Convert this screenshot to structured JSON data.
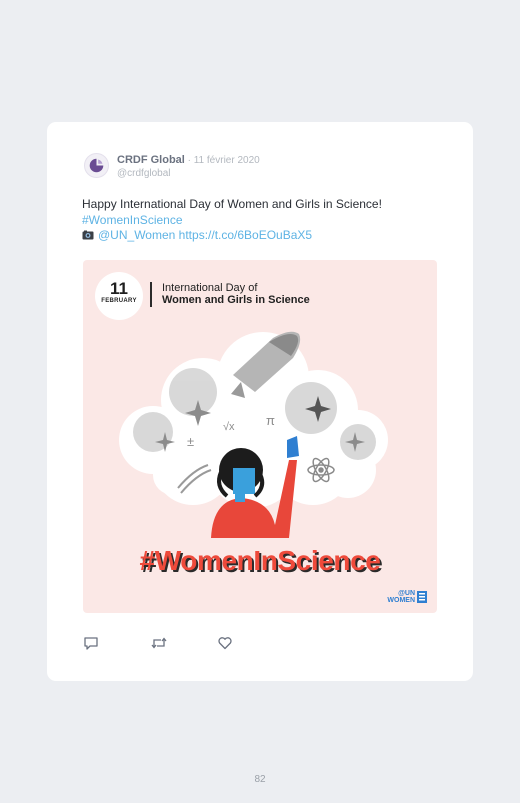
{
  "tweet": {
    "author_name": "CRDF Global",
    "separator": " · ",
    "date": "11 février 2020",
    "handle": "@crdfglobal",
    "text_line1": "Happy International Day of Women and Girls in Science!",
    "hashtag": "#WomenInScience",
    "mention": "@UN_Women",
    "link": "https://t.co/6BoEOuBaX5"
  },
  "media": {
    "badge_day": "11",
    "badge_month": "FEBRUARY",
    "event_line1": "International Day of",
    "event_line2": "Women and Girls in Science",
    "big_hashtag": "#WomenInScience",
    "logo_line1": "@UN",
    "logo_line2": "WOMEN"
  },
  "actions": [
    {
      "icon": "reply-icon"
    },
    {
      "icon": "retweet-icon"
    },
    {
      "icon": "like-icon"
    }
  ],
  "page_number": "82",
  "colors": {
    "background": "#eceef2",
    "card": "#ffffff",
    "link": "#5eb3e4",
    "media_bg": "#fbe8e6",
    "accent_red": "#ee4a3b",
    "un_women_blue": "#2f7fd1"
  }
}
